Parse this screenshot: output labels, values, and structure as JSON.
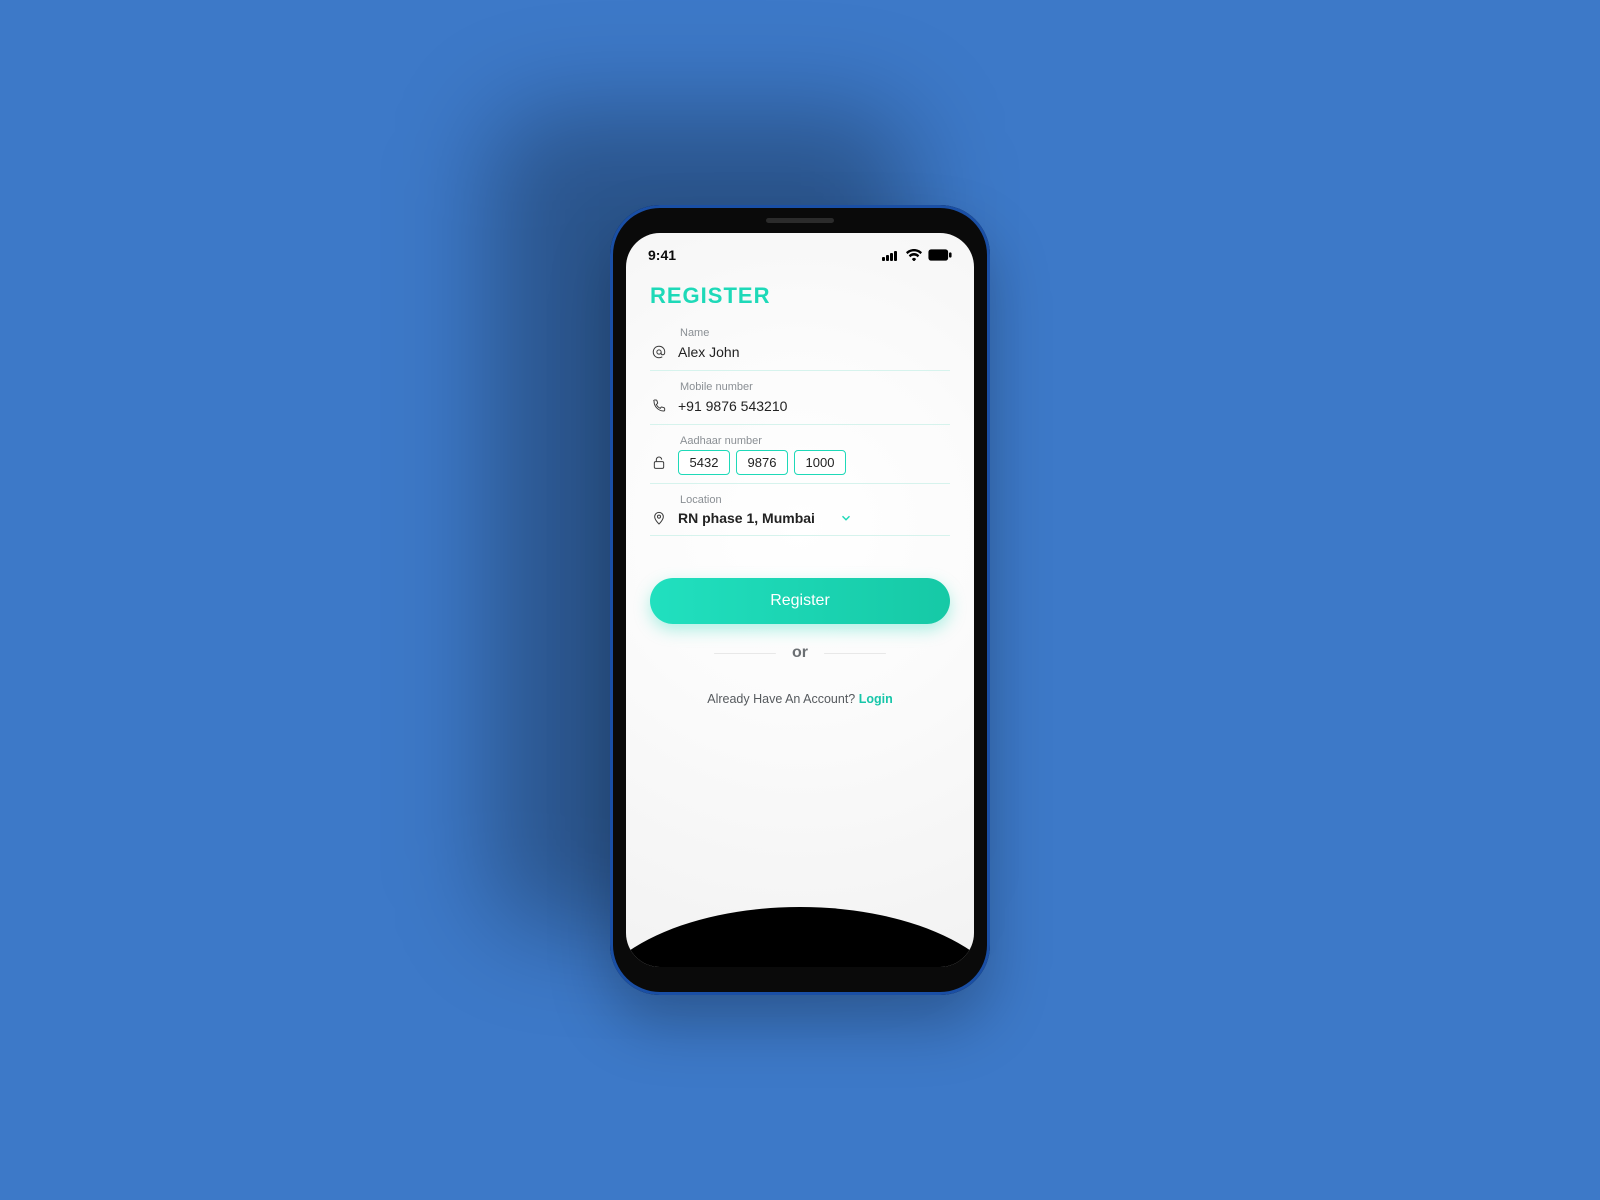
{
  "statusbar": {
    "time": "9:41"
  },
  "page": {
    "title": "REGISTER"
  },
  "fields": {
    "name": {
      "label": "Name",
      "value": "Alex John"
    },
    "mobile": {
      "label": "Mobile number",
      "value": "+91 9876 543210"
    },
    "aadhaar": {
      "label": "Aadhaar number",
      "part1": "5432",
      "part2": "9876",
      "part3": "1000"
    },
    "location": {
      "label": "Location",
      "value": "RN phase 1, Mumbai"
    }
  },
  "actions": {
    "register_label": "Register",
    "or_label": "or",
    "already_text": "Already Have An Account? ",
    "login_label": "Login"
  }
}
